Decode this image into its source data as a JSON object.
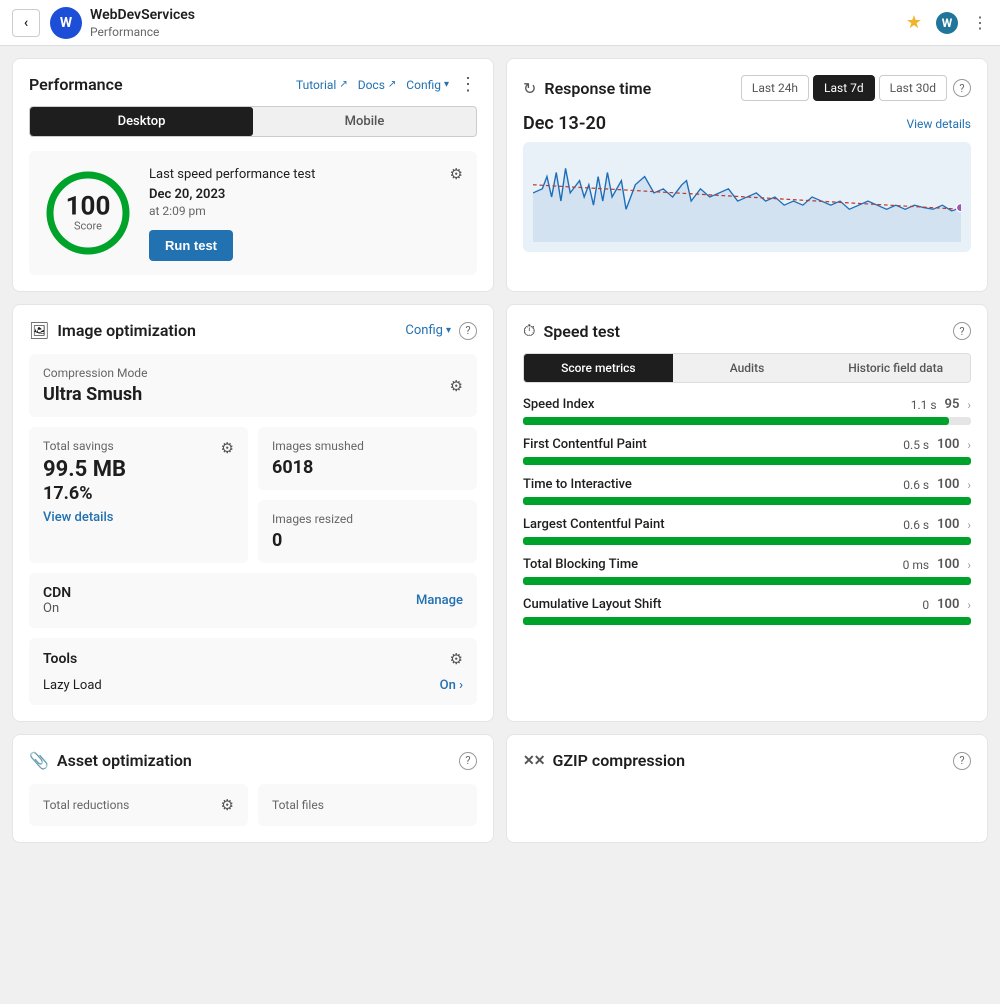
{
  "topbar": {
    "back_label": "‹",
    "avatar_letter": "W",
    "site_name": "WebDevServices",
    "subtitle": "Performance",
    "star_icon": "★",
    "wp_icon": "W",
    "more_icon": "⋮"
  },
  "performance_card": {
    "title": "Performance",
    "nav": {
      "tutorial": "Tutorial",
      "docs": "Docs",
      "config": "Config"
    },
    "toggle": {
      "desktop": "Desktop",
      "mobile": "Mobile"
    },
    "score": {
      "value": "100",
      "label": "Score"
    },
    "last_test": {
      "label": "Last speed performance test",
      "date": "Dec 20, 2023",
      "time": "at 2:09 pm"
    },
    "run_test_btn": "Run test"
  },
  "image_optimization": {
    "title": "Image optimization",
    "config_label": "Config",
    "compression": {
      "label": "Compression Mode",
      "value": "Ultra Smush"
    },
    "total_savings": {
      "label": "Total savings",
      "value_mb": "99.5 MB",
      "value_pct": "17.6%",
      "view_details": "View details"
    },
    "images_smushed": {
      "label": "Images smushed",
      "value": "6018"
    },
    "images_resized": {
      "label": "Images resized",
      "value": "0"
    },
    "cdn": {
      "label": "CDN",
      "status": "On",
      "manage": "Manage"
    },
    "tools": {
      "label": "Tools",
      "lazy_load": "Lazy Load",
      "lazy_status": "On ›"
    }
  },
  "response_time": {
    "title": "Response time",
    "tabs": [
      "Last 24h",
      "Last 7d",
      "Last 30d"
    ],
    "active_tab": "Last 7d",
    "date_range": "Dec 13-20",
    "view_details": "View details"
  },
  "speed_test": {
    "title": "Speed test",
    "tabs": [
      "Score metrics",
      "Audits",
      "Historic field data"
    ],
    "active_tab": "Score metrics",
    "metrics": [
      {
        "label": "Speed Index",
        "score": 95,
        "time": "1.1 s",
        "pct": 95
      },
      {
        "label": "First Contentful Paint",
        "score": 100,
        "time": "0.5 s",
        "pct": 100
      },
      {
        "label": "Time to Interactive",
        "score": 100,
        "time": "0.6 s",
        "pct": 100
      },
      {
        "label": "Largest Contentful Paint",
        "score": 100,
        "time": "0.6 s",
        "pct": 100
      },
      {
        "label": "Total Blocking Time",
        "score": 100,
        "time": "0 ms",
        "pct": 100
      },
      {
        "label": "Cumulative Layout Shift",
        "score": 100,
        "time": "0",
        "pct": 100
      }
    ]
  },
  "asset_optimization": {
    "title": "Asset optimization",
    "total_reductions_label": "Total reductions",
    "total_files_label": "Total files"
  },
  "gzip": {
    "title": "GZIP compression"
  },
  "icons": {
    "image_icon": "🖼",
    "asset_icon": "📎",
    "gzip_icon": "✕✕",
    "refresh_icon": "↻",
    "speed_icon": "⏱"
  }
}
